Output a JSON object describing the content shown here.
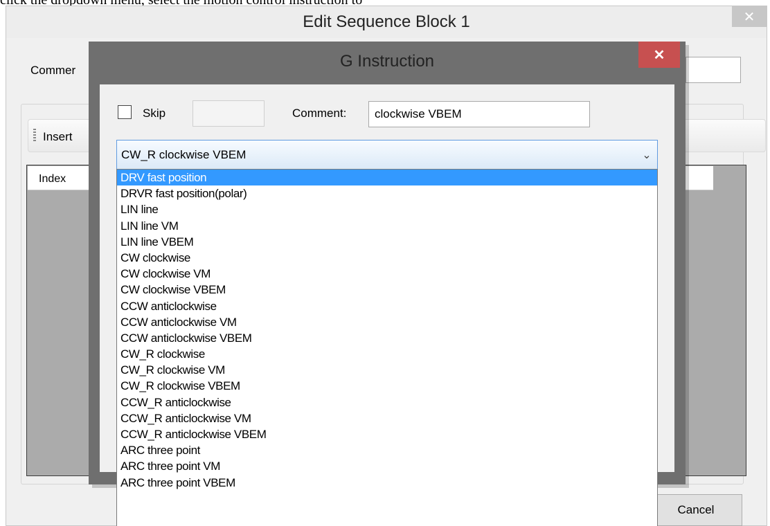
{
  "doc": {
    "top_text": "click the dropdown menu, select the motion control instruction to"
  },
  "outer": {
    "title": "Edit Sequence Block 1",
    "close_glyph": "✕",
    "comment_label": "Commer",
    "toolbar_insert": "Insert",
    "grid_index_header": "Index",
    "cancel_label": "Cancel"
  },
  "modal": {
    "title": "G Instruction",
    "close_glyph": "✕",
    "skip_label": "Skip",
    "skip_checked": false,
    "skip_value": "",
    "comment_label": "Comment:",
    "comment_value": "clockwise VBEM",
    "combo_value": "CW_R clockwise VBEM",
    "combo_arrow_glyph": "⌄"
  },
  "dropdown": {
    "selected_index": 0,
    "items": [
      "DRV fast position",
      "DRVR fast position(polar)",
      "LIN line",
      "LIN line VM",
      "LIN line VBEM",
      "CW clockwise",
      "CW clockwise VM",
      "CW clockwise VBEM",
      "CCW anticlockwise",
      "CCW anticlockwise VM",
      "CCW anticlockwise VBEM",
      "CW_R clockwise",
      "CW_R clockwise VM",
      "CW_R clockwise VBEM",
      "CCW_R anticlockwise",
      "CCW_R anticlockwise VM",
      "CCW_R anticlockwise VBEM",
      "ARC three point",
      "ARC three point VM",
      "ARC three point VBEM"
    ]
  },
  "colors": {
    "modal_close_bg": "#c75050",
    "selection_bg": "#3399ff",
    "combo_border": "#5f9ae0",
    "grid_bg": "#ababab"
  }
}
